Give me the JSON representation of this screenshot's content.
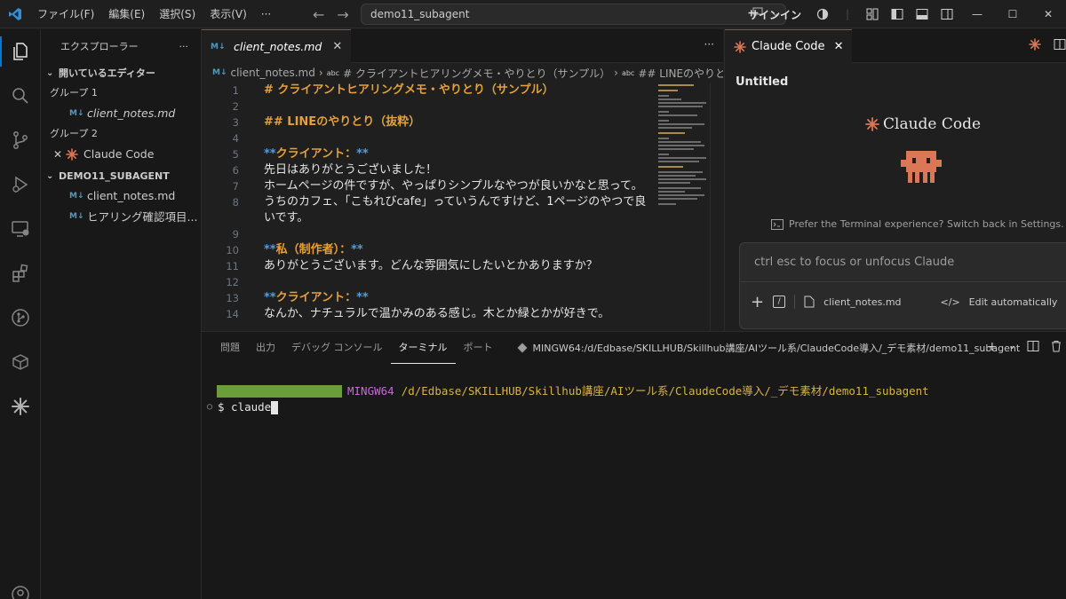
{
  "titlebar": {
    "menu": [
      "ファイル(F)",
      "編集(E)",
      "選択(S)",
      "表示(V)",
      "···"
    ],
    "search_text": "demo11_subagent",
    "signin_label": "サインイン"
  },
  "sidebar": {
    "title": "エクスプローラー",
    "more": "···",
    "open_editors_label": "開いているエディター",
    "group1_label": "グループ 1",
    "group1_file": "client_notes.md",
    "group2_label": "グループ 2",
    "group2_item": "Claude Code",
    "project_label": "DEMO11_SUBAGENT",
    "files": [
      "client_notes.md",
      "ヒアリング確認項目..."
    ],
    "md_badge": "M↓"
  },
  "editor": {
    "tab_label": "client_notes.md",
    "breadcrumb": [
      "client_notes.md",
      "# クライアントヒアリングメモ・やりとり（サンプル）",
      "## LINEのやりとり（抜"
    ],
    "lines": [
      {
        "n": "1",
        "text": "# クライアントヒアリングメモ・やりとり（サンプル）",
        "kind": "h"
      },
      {
        "n": "2",
        "text": "",
        "kind": "plain"
      },
      {
        "n": "3",
        "text": "## LINEのやりとり（抜粋）",
        "kind": "h"
      },
      {
        "n": "4",
        "text": "",
        "kind": "plain"
      },
      {
        "n": "5",
        "text": "クライアント：",
        "kind": "bold"
      },
      {
        "n": "6",
        "text": "先日はありがとうございました！",
        "kind": "plain"
      },
      {
        "n": "7",
        "text": "ホームページの件ですが、やっぱりシンプルなやつが良いかなと思って。",
        "kind": "plain"
      },
      {
        "n": "8",
        "text": "うちのカフェ、「こもれびcafe」っていうんですけど、1ページのやつで良いです。",
        "kind": "plain"
      },
      {
        "n": "9",
        "text": "",
        "kind": "plain"
      },
      {
        "n": "10",
        "text": "私（制作者）：",
        "kind": "bold"
      },
      {
        "n": "11",
        "text": "ありがとうございます。どんな雰囲気にしたいとかありますか？",
        "kind": "plain"
      },
      {
        "n": "12",
        "text": "",
        "kind": "plain"
      },
      {
        "n": "13",
        "text": "クライアント：",
        "kind": "bold"
      },
      {
        "n": "14",
        "text": "なんか、ナチュラルで温かみのある感じ。木とか緑とかが好きで。",
        "kind": "plain"
      }
    ]
  },
  "claude_panel": {
    "tab_label": "Claude Code",
    "session_title": "Untitled",
    "logo_text": "Claude Code",
    "pref_text": "Prefer the Terminal experience? Switch back in Settings.",
    "input_placeholder": "ctrl esc to focus or unfocus Claude",
    "file_chip": "client_notes.md",
    "edit_mode": "Edit automatically"
  },
  "panel": {
    "tabs": [
      "問題",
      "出力",
      "デバッグ コンソール",
      "ターミナル",
      "ポート"
    ],
    "active_tab": "ターミナル",
    "terminal_name": "MINGW64:/d/Edbase/SKILLHUB/Skillhub講座/AIツール系/ClaudeCode導入/_デモ素材/demo11_subagent",
    "prompt_host": "MINGW64",
    "prompt_path": "/d/Edbase/SKILLHUB/Skillhub講座/AIツール系/ClaudeCode導入/_デモ素材/demo11_subagent",
    "command": "$ claude"
  },
  "colors": {
    "accent": "#0078d4",
    "heading": "#e5a03a",
    "claude_orange": "#d97757",
    "mingw": "#c56bd6",
    "path": "#d7b24a"
  }
}
